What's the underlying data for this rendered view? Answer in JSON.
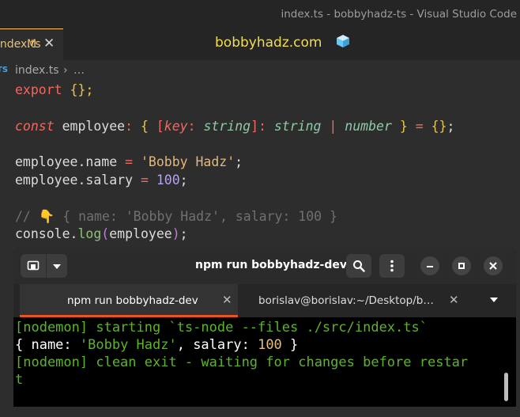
{
  "window": {
    "title": "index.ts - bobbyhadz-ts - Visual Studio Code"
  },
  "editor_tab": {
    "label": "index.ts",
    "modified_marker": "M",
    "close_glyph": "✕"
  },
  "brand": {
    "text": "bobbyhadz.com",
    "icon": "ice-cube-icon"
  },
  "breadcrumb": {
    "file_badge": "TS",
    "file": "index.ts",
    "separator": "›",
    "more": "…"
  },
  "code": {
    "line1": {
      "kw": "export",
      "rest": " {};"
    },
    "line3": {
      "const": "const",
      "name": " employee",
      "colon": ": ",
      "lbrace": "{ ",
      "lbracket": "[",
      "key": "key",
      "keycolon": ": ",
      "string_type": "string",
      "rbracket": "]",
      "colon2": ": ",
      "string_type2": "string",
      "pipe": " | ",
      "number_type": "number",
      "rbrace": " }",
      "eq": " = ",
      "init": "{}",
      "semi": ";"
    },
    "line5": {
      "obj": "employee.name",
      "eq": " = ",
      "value": "'Bobby Hadz'",
      "semi": ";"
    },
    "line6": {
      "obj": "employee.salary",
      "eq": " = ",
      "value": "100",
      "semi": ";"
    },
    "line8": {
      "comment": "// 👇 { name: 'Bobby Hadz', salary: 100 }"
    },
    "line9": {
      "obj": "console.",
      "fn": "log",
      "lparen": "(",
      "arg": "employee",
      "rparen": ")",
      "semi": ";"
    }
  },
  "terminal": {
    "title": "npm run bobbyhadz-dev",
    "tabs": [
      {
        "label": "npm run bobbyhadz-dev",
        "close": "✕"
      },
      {
        "label": "borislav@borislav:~/Desktop/b…",
        "close": "✕"
      }
    ],
    "output": {
      "line1": "[nodemon] starting `ts-node --files ./src/index.ts`",
      "line2_open": "{ name: ",
      "line2_str": "'Bobby Hadz'",
      "line2_mid": ", salary: ",
      "line2_num": "100",
      "line2_close": " }",
      "line3": "[nodemon] clean exit - waiting for changes before restar",
      "line4": "t"
    },
    "header_icons": [
      "new-tab-icon",
      "dropdown-icon",
      "search-icon",
      "menu-icon",
      "minimize-icon",
      "maximize-icon",
      "close-icon"
    ]
  },
  "colors": {
    "accent_tab": "#e95420",
    "editor_bg": "#2c2d2c",
    "brand": "#f0dd54"
  }
}
